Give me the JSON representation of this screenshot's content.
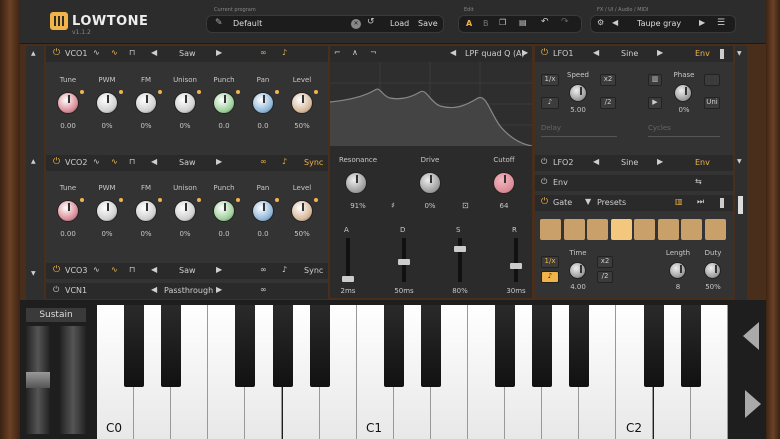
{
  "app": {
    "name": "LOWTONE",
    "version": "v1.1.2"
  },
  "header": {
    "program_label": "Current program",
    "program_name": "Default",
    "load": "Load",
    "save": "Save",
    "edit_label": "Edit",
    "edit_a": "A",
    "edit_b": "B",
    "fx_label": "FX / UI / Audio / MIDI",
    "theme_name": "Taupe gray"
  },
  "vco1": {
    "name": "VCO1",
    "wave": "Saw",
    "knobs": [
      {
        "label": "Tune",
        "value": "0.00",
        "color": "#d98a96"
      },
      {
        "label": "PWM",
        "value": "0%",
        "color": "#cfcfcf"
      },
      {
        "label": "FM",
        "value": "0%",
        "color": "#cfcfcf"
      },
      {
        "label": "Unison",
        "value": "0%",
        "color": "#cfcfcf"
      },
      {
        "label": "Punch",
        "value": "0.0",
        "color": "#9ccf9a"
      },
      {
        "label": "Pan",
        "value": "0.0",
        "color": "#8fb6d8"
      },
      {
        "label": "Level",
        "value": "50%",
        "color": "#d6b89a"
      }
    ]
  },
  "vco2": {
    "name": "VCO2",
    "wave": "Saw",
    "sync": "Sync",
    "knobs": [
      {
        "label": "Tune",
        "value": "0.00",
        "color": "#d98a96"
      },
      {
        "label": "PWM",
        "value": "0%",
        "color": "#cfcfcf"
      },
      {
        "label": "FM",
        "value": "0%",
        "color": "#cfcfcf"
      },
      {
        "label": "Unison",
        "value": "0%",
        "color": "#cfcfcf"
      },
      {
        "label": "Punch",
        "value": "0.0",
        "color": "#9ccf9a"
      },
      {
        "label": "Pan",
        "value": "0.0",
        "color": "#8fb6d8"
      },
      {
        "label": "Level",
        "value": "50%",
        "color": "#d6b89a"
      }
    ]
  },
  "vco3": {
    "name": "VCO3",
    "wave": "Saw",
    "sync": "Sync"
  },
  "vcn1": {
    "name": "VCN1",
    "mode": "Passthrough"
  },
  "filter": {
    "type": "LPF quad Q (A)",
    "resonance_label": "Resonance",
    "resonance": "91%",
    "drive_label": "Drive",
    "drive": "0%",
    "cutoff_label": "Cutoff",
    "cutoff": "64",
    "adsr": [
      {
        "label": "A",
        "value": "2ms",
        "level": 0.0
      },
      {
        "label": "D",
        "value": "50ms",
        "level": 0.45
      },
      {
        "label": "S",
        "value": "80%",
        "level": 0.8
      },
      {
        "label": "R",
        "value": "30ms",
        "level": 0.35
      }
    ]
  },
  "lfo1": {
    "name": "LFO1",
    "wave": "Sine",
    "env": "Env",
    "one_x": "1/x",
    "speed_label": "Speed",
    "speed": "5.00",
    "x2": "x2",
    "div2": "/2",
    "phase_label": "Phase",
    "phase": "0%",
    "uni": "Uni",
    "delay": "Delay",
    "cycles": "Cycles"
  },
  "lfo2": {
    "name": "LFO2",
    "wave": "Sine",
    "env": "Env"
  },
  "env_row": {
    "name": "Env"
  },
  "gate": {
    "name": "Gate",
    "presets": "Presets",
    "one_x": "1/x",
    "x2": "x2",
    "div2": "/2",
    "time_label": "Time",
    "time": "4.00",
    "length_label": "Length",
    "length": "8",
    "duty_label": "Duty",
    "duty": "50%"
  },
  "keyboard": {
    "sustain": "Sustain",
    "c0": "C0",
    "c1": "C1",
    "c2": "C2"
  }
}
